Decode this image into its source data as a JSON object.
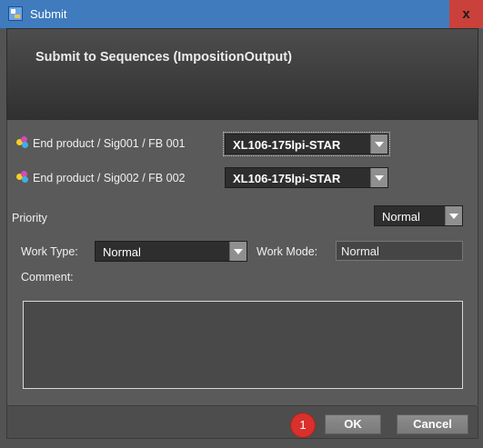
{
  "window": {
    "title": "Submit",
    "close_label": "x",
    "header_title": "Submit to Sequences (ImpositionOutput)"
  },
  "products": [
    {
      "label": "End product / Sig001 / FB 001",
      "value": "XL106-175lpi-STAR",
      "icon": "color-palette-icon"
    },
    {
      "label": "End product / Sig002 / FB 002",
      "value": "XL106-175lpi-STAR",
      "icon": "color-palette-icon"
    }
  ],
  "priority": {
    "label": "Priority",
    "value": "Normal"
  },
  "work": {
    "type_label": "Work Type:",
    "type_value": "Normal",
    "mode_label": "Work Mode:",
    "mode_value": "Normal"
  },
  "comment": {
    "label": "Comment:",
    "value": ""
  },
  "buttons": {
    "ok": "OK",
    "cancel": "Cancel"
  },
  "annotation": {
    "badge": "1"
  },
  "colors": {
    "titlebar": "#3f7bbd",
    "close": "#c9413a",
    "badge": "#d9302c",
    "background": "#5a5a5a"
  }
}
